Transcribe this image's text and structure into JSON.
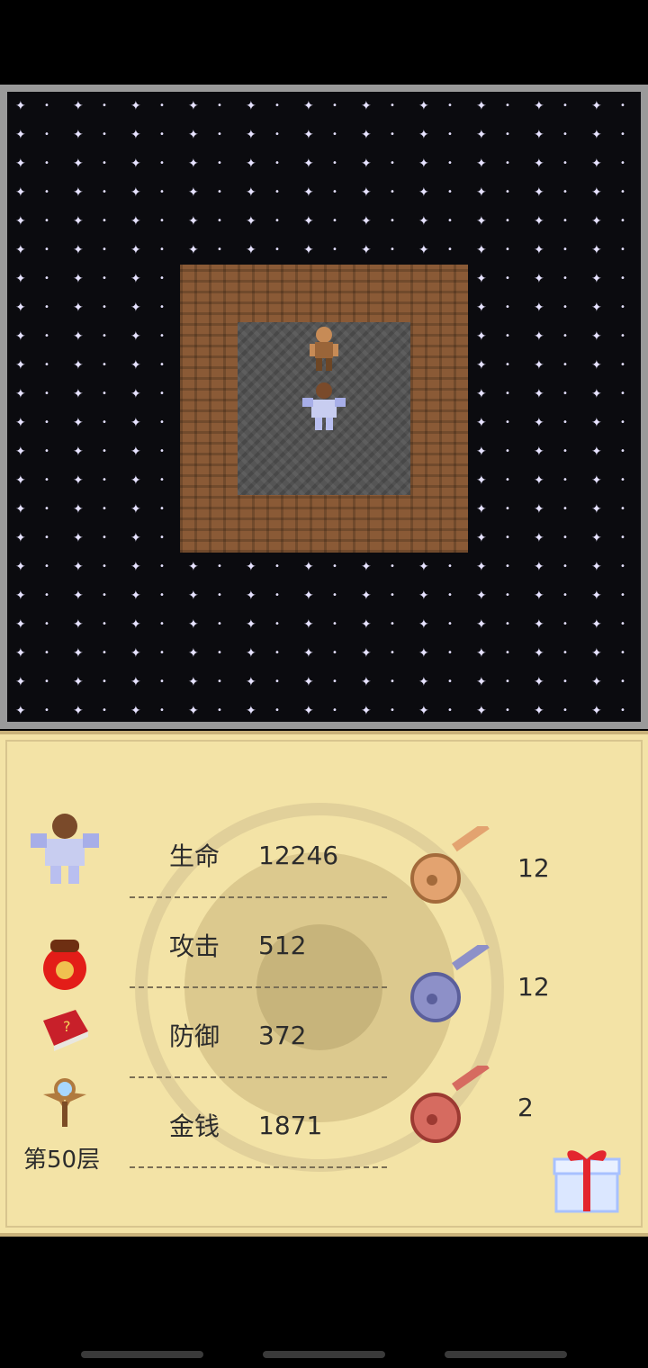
{
  "stats": {
    "hp_label": "生命",
    "hp_value": "12246",
    "atk_label": "攻击",
    "atk_value": "512",
    "def_label": "防御",
    "def_value": "372",
    "gold_label": "金钱",
    "gold_value": "1871"
  },
  "floor": {
    "label": "第50层"
  },
  "keys": {
    "yellow": "12",
    "blue": "12",
    "red": "2"
  },
  "icons": {
    "hero_portrait": "hero-portrait-icon",
    "lucky_bag": "lucky-bag-icon",
    "monster_book": "monster-book-icon",
    "floor_fly": "floor-fly-staff-icon",
    "yellow_key": "yellow-key-icon",
    "blue_key": "blue-key-icon",
    "red_key": "red-key-icon",
    "gift": "gift-box-icon"
  },
  "colors": {
    "background": "#000000",
    "board_border": "#9a9a9a",
    "stars": "#e6e2ff",
    "wall": "#8a5a36",
    "floor_tile": "#555555",
    "panel": "#f3e3a6",
    "yellow_key": "#e3a370",
    "blue_key": "#8d90c8",
    "red_key": "#d66b60"
  }
}
